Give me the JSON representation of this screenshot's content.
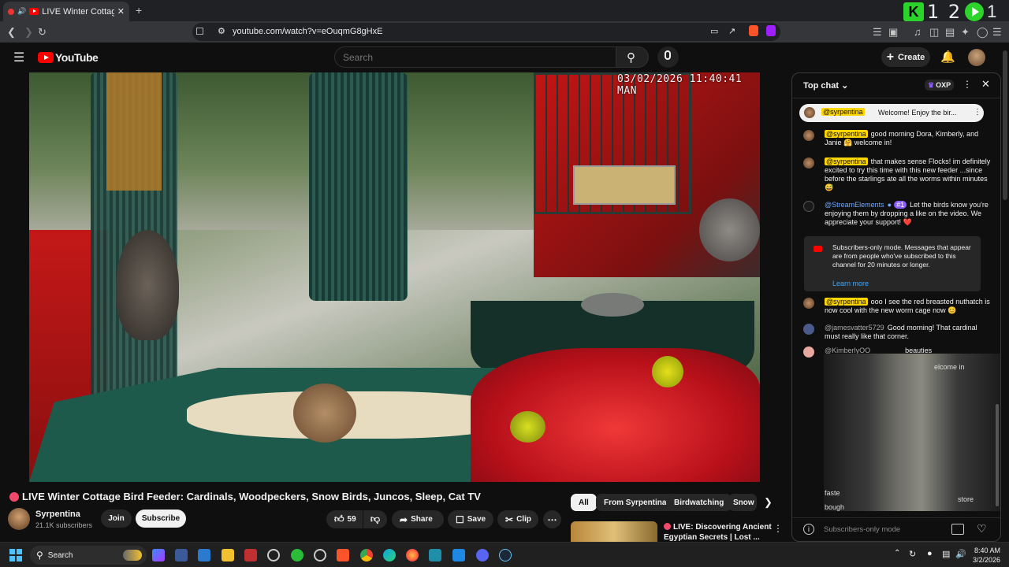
{
  "browser": {
    "tab_title": "LIVE Winter Cottage Bird F",
    "url": "youtube.com/watch?v=eOuqmG8gHxE",
    "overlay_count": "1 2"
  },
  "youtube": {
    "logo_text": "YouTube",
    "search_placeholder": "Search",
    "create_label": "Create"
  },
  "video": {
    "timestamp_overlay": "03/02/2026 11:40:41 MAN"
  },
  "info": {
    "title": "LIVE Winter Cottage Bird Feeder: Cardinals, Woodpeckers, Snow Birds, Juncos, Sleep, Cat TV",
    "channel": "Syrpentina",
    "subscribers": "21.1K subscribers",
    "join_label": "Join",
    "subscribe_label": "Subscribe",
    "likes": "59",
    "share_label": "Share",
    "save_label": "Save",
    "clip_label": "Clip"
  },
  "chips": [
    "All",
    "From Syrpentina",
    "Birdwatching",
    "Snow"
  ],
  "recommended": {
    "title_line1": "LIVE: Discovering Ancient",
    "title_line2": "Egyptian Secrets | Lost ..."
  },
  "chat": {
    "header": "Top chat",
    "points": "OXP",
    "pinned_user": "@syrpentina",
    "pinned_text": "Welcome! Enjoy the bir...",
    "messages": [
      {
        "user": "@syrpentina",
        "text": "good morning Dora, Kimberly, and Janie 🤗 welcome in!"
      },
      {
        "user": "@syrpentina",
        "text": "that makes sense Flocks! im definitely excited to try this time with this new feeder ...since before the starlings ate all the worms within minutes 😅"
      },
      {
        "user": "@StreamElements",
        "badge": "#1",
        "text": "Let the birds know you're enjoying them by dropping a like on the video. We appreciate your support! ❤️"
      },
      {
        "user": "@syrpentina",
        "text": "ooo I see the red breasted nuthatch is now cool with the new worm cage now 😊"
      },
      {
        "user": "@jamesvatter5729",
        "text": "Good morning! That cardinal must really like that corner."
      },
      {
        "user": "@KimberlyOO",
        "text": "beauties"
      }
    ],
    "notice_text": "Subscribers-only mode. Messages that appear are from people who've subscribed to this channel for 20 minutes or longer.",
    "learn_more": "Learn more",
    "partial_welcome": "elcome in",
    "partial_lines": [
      "faste",
      "bough"
    ],
    "partial_store": "store",
    "input_placeholder": "Subscribers-only mode"
  },
  "taskbar": {
    "search_label": "Search",
    "time": "8:40 AM",
    "date": "3/2/2026"
  },
  "colors": {
    "accent_red": "#ff0000",
    "highlight_yellow": "#ffd600",
    "overlay_green": "#2bd32b"
  }
}
